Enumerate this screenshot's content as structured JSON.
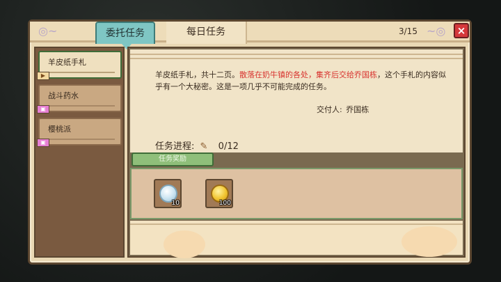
{
  "header": {
    "tabs": [
      {
        "label": "委托任务",
        "active": true
      },
      {
        "label": "每日任务",
        "active": false
      }
    ],
    "counter": "3/15",
    "close_label": "×"
  },
  "sidebar": {
    "items": [
      {
        "label": "羊皮纸手札",
        "selected": true,
        "badge_icon": "flag-icon"
      },
      {
        "label": "战斗药水",
        "selected": false,
        "badge_icon": "bag-icon"
      },
      {
        "label": "樱桃派",
        "selected": false,
        "badge_icon": "bag-icon"
      }
    ]
  },
  "detail": {
    "desc_part1": "羊皮纸手札，共十二页。",
    "desc_red": "散落在奶牛镇的各处，集齐后交给乔国栋",
    "desc_part2": "，这个手札的内容似乎有一个大秘密。这是一项几乎不可能完成的任务。",
    "giver_label": "交付人:",
    "giver_name": "乔国栋",
    "progress_label": "任务进程:",
    "progress_value": "0/12",
    "reward_tab_label": "任务奖励",
    "rewards": [
      {
        "icon": "diamond-icon",
        "qty": "10"
      },
      {
        "icon": "coin-icon",
        "qty": "100"
      }
    ]
  },
  "colors": {
    "panel_bg": "#e9d8b4",
    "tab_active": "#7fc6c4",
    "accent_red": "#d8332f",
    "reward_tab": "#8fbf7a"
  }
}
